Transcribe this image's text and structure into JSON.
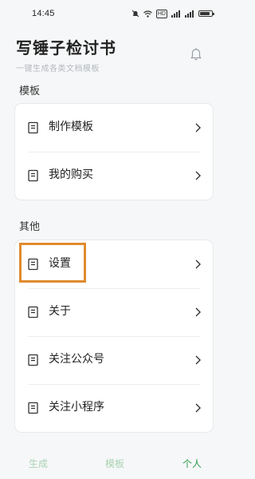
{
  "status_bar": {
    "time": "14:45",
    "hd_label": "HD",
    "battery_level": 0.85
  },
  "header": {
    "title": "写锤子检讨书",
    "subtitle": "一键生成各类文档模板",
    "bell_icon": "bell-icon"
  },
  "sections": [
    {
      "title": "模板",
      "items": [
        {
          "label": "制作模板",
          "icon": "document-icon"
        },
        {
          "label": "我的购买",
          "icon": "document-icon"
        }
      ]
    },
    {
      "title": "其他",
      "items": [
        {
          "label": "设置",
          "icon": "document-icon",
          "highlighted": true
        },
        {
          "label": "关于",
          "icon": "document-icon"
        },
        {
          "label": "关注公众号",
          "icon": "document-icon"
        },
        {
          "label": "关注小程序",
          "icon": "document-icon"
        }
      ]
    }
  ],
  "bottom_nav": {
    "tabs": [
      {
        "label": "生成",
        "active": false
      },
      {
        "label": "模板",
        "active": false
      },
      {
        "label": "个人",
        "active": true
      }
    ]
  },
  "colors": {
    "accent": "#2d9a4d",
    "accent_light": "#a9d3b4",
    "highlight_border": "#e08a2e",
    "background": "#f6f7f8",
    "card": "#ffffff"
  }
}
